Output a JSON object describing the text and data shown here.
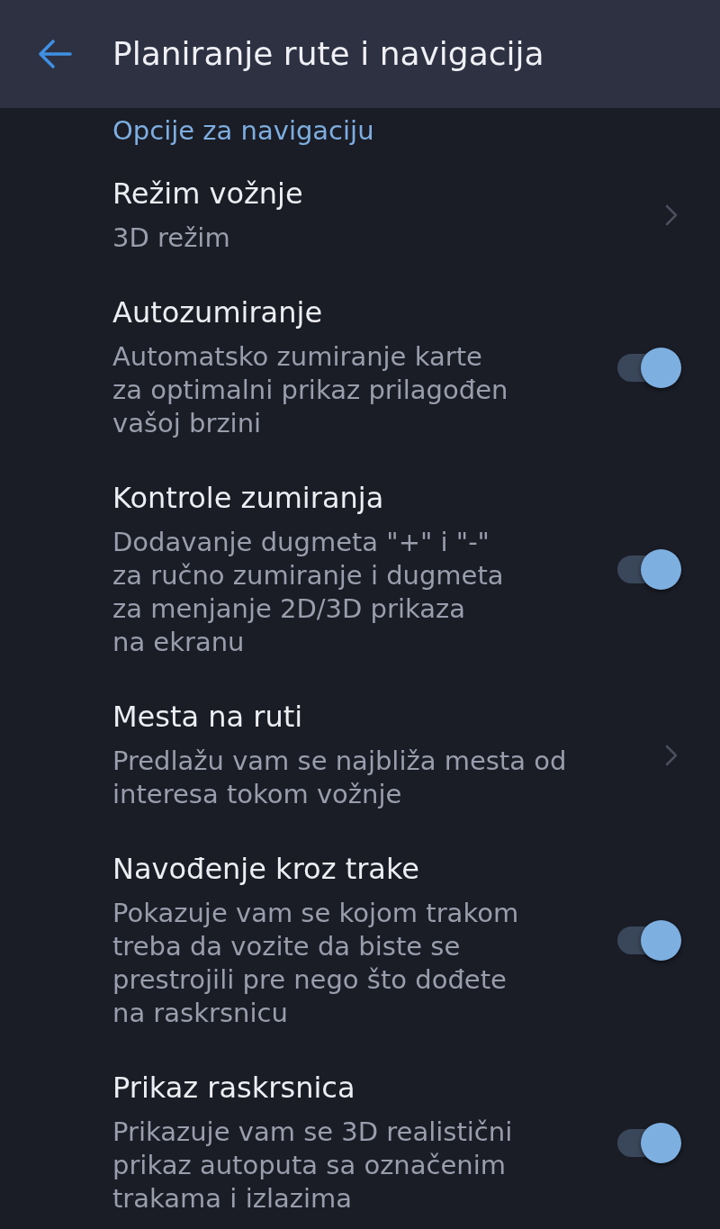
{
  "header": {
    "title": "Planiranje rute i navigacija"
  },
  "section": {
    "title": "Opcije za navigaciju"
  },
  "items": [
    {
      "kind": "link",
      "title": "Režim vožnje",
      "subtitle": "3D režim"
    },
    {
      "kind": "toggle",
      "title": "Autozumiranje",
      "subtitle": "Automatsko zumiranje karte\nza optimalni prikaz prilagođen\nvašoj brzini",
      "on": true
    },
    {
      "kind": "toggle",
      "title": "Kontrole zumiranja",
      "subtitle": "Dodavanje dugmeta \"+\" i \"-\"\nza ručno zumiranje i dugmeta\nza menjanje 2D/3D prikaza\nna ekranu",
      "on": true
    },
    {
      "kind": "link",
      "title": "Mesta na ruti",
      "subtitle": "Predlažu vam se najbliža mesta od\ninteresa tokom vožnje"
    },
    {
      "kind": "toggle",
      "title": "Navođenje kroz trake",
      "subtitle": "Pokazuje vam se kojom trakom\ntreba da vozite da biste se\nprestrojili pre nego što dođete\nna raskrsnicu",
      "on": true
    },
    {
      "kind": "toggle",
      "title": "Prikaz raskrsnica",
      "subtitle": "Prikazuje vam se 3D realistični\nprikaz autoputa sa označenim\ntrakama i izlazima",
      "on": true
    }
  ]
}
